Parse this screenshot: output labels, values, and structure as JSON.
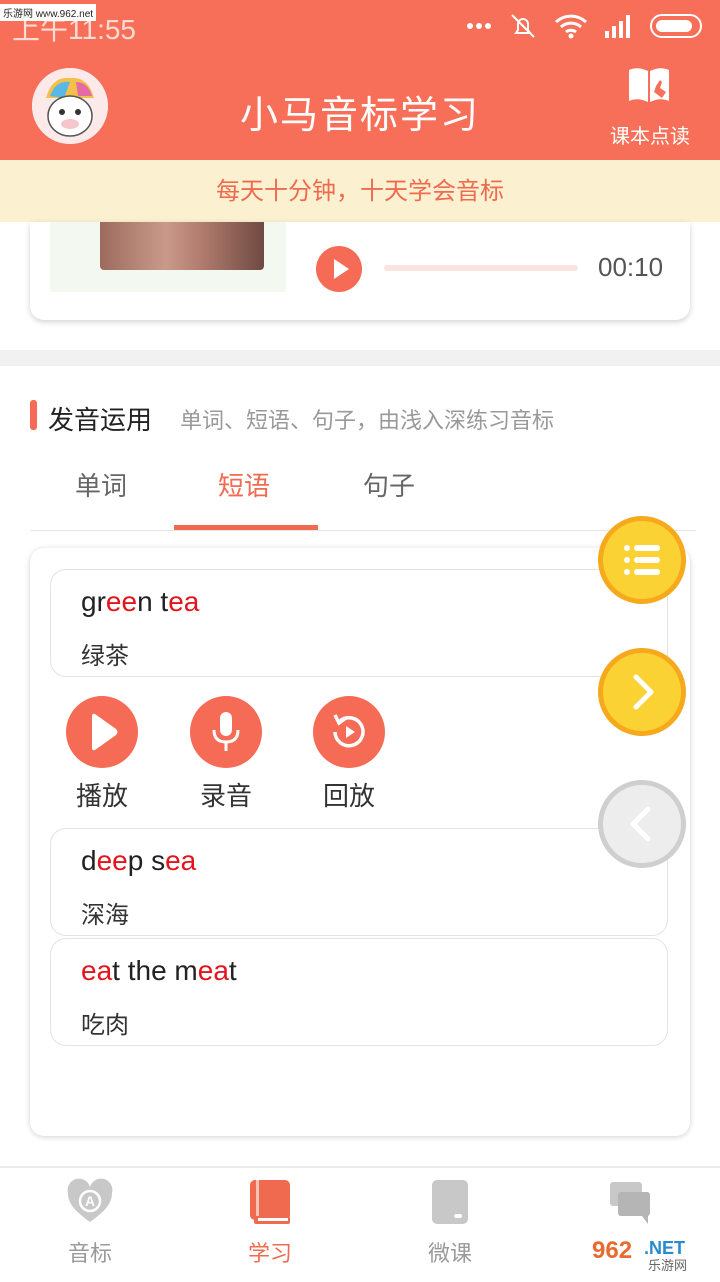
{
  "status_bar": {
    "time": "上午11:55",
    "watermark": "乐游网 www.962.net"
  },
  "header": {
    "title": "小马音标学习",
    "book_button_label": "课本点读"
  },
  "banner": {
    "text": "每天十分钟，十天学会音标"
  },
  "audio_player": {
    "duration": "00:10",
    "progress": 0
  },
  "section": {
    "title": "发音运用",
    "description": "单词、短语、句子，由浅入深练习音标"
  },
  "tabs": [
    {
      "label": "单词",
      "active": false
    },
    {
      "label": "短语",
      "active": true
    },
    {
      "label": "句子",
      "active": false
    }
  ],
  "phrases": [
    {
      "segments": [
        [
          "gr",
          false
        ],
        [
          "ee",
          true
        ],
        [
          "n t",
          false
        ],
        [
          "ea",
          true
        ]
      ],
      "translation": "绿茶"
    },
    {
      "segments": [
        [
          "d",
          false
        ],
        [
          "ee",
          true
        ],
        [
          "p s",
          false
        ],
        [
          "ea",
          true
        ]
      ],
      "translation": "深海"
    },
    {
      "segments": [
        [
          "ea",
          true
        ],
        [
          "t the m",
          false
        ],
        [
          "ea",
          true
        ],
        [
          "t",
          false
        ]
      ],
      "translation": "吃肉"
    }
  ],
  "actions": {
    "play_label": "播放",
    "record_label": "录音",
    "replay_label": "回放"
  },
  "bottom_nav": [
    {
      "label": "音标",
      "icon": "phonetic-icon",
      "active": false
    },
    {
      "label": "学习",
      "icon": "book-icon",
      "active": true
    },
    {
      "label": "微课",
      "icon": "tablet-icon",
      "active": false
    },
    {
      "label": "",
      "icon": "chat-icon",
      "active": false
    }
  ],
  "watermark_bottom": "962.NET 乐游网",
  "colors": {
    "primary": "#F76F58",
    "highlight": "#E3141B",
    "banner_bg": "#FBF1D0",
    "fab_yellow": "#FBD234"
  }
}
